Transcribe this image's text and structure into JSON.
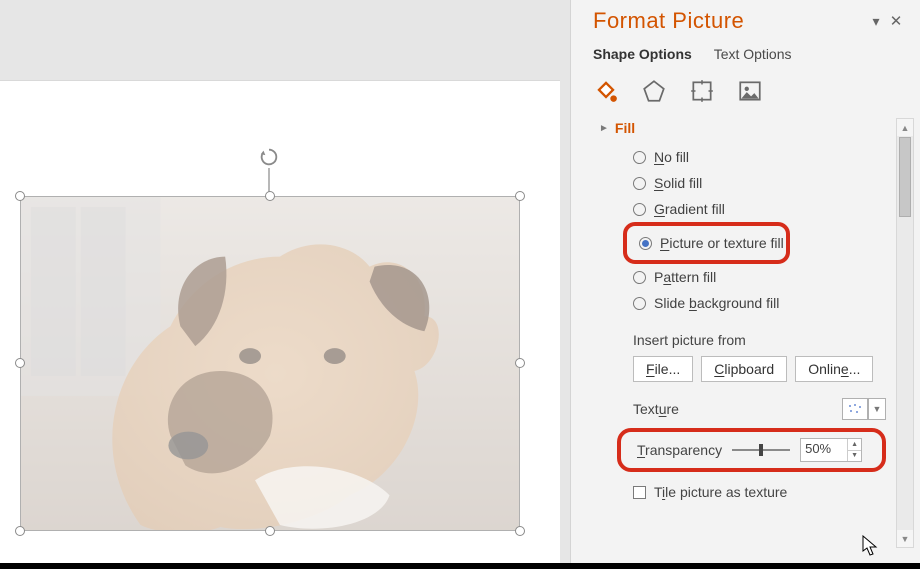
{
  "pane": {
    "title": "Format Picture",
    "tabs": {
      "shape": "Shape Options",
      "text": "Text Options"
    },
    "fill": {
      "section": "Fill",
      "items": {
        "no": {
          "pre": "",
          "u": "N",
          "post": "o fill"
        },
        "solid": {
          "pre": "",
          "u": "S",
          "post": "olid fill"
        },
        "gradient": {
          "pre": "",
          "u": "G",
          "post": "radient fill"
        },
        "picture": {
          "pre": "",
          "u": "P",
          "post": "icture or texture fill"
        },
        "pattern": {
          "pre": "P",
          "u": "a",
          "post": "ttern fill"
        },
        "slidebg": {
          "pre": "Slide ",
          "u": "b",
          "post": "ackground fill"
        }
      },
      "insert_label": "Insert picture from",
      "buttons": {
        "file": {
          "pre": "",
          "u": "F",
          "post": "ile..."
        },
        "clipboard": {
          "pre": "",
          "u": "C",
          "post": "lipboard"
        },
        "online": {
          "pre": "Onlin",
          "u": "e",
          "post": "..."
        }
      },
      "texture_label": {
        "pre": "Text",
        "u": "u",
        "post": "re"
      },
      "transparency": {
        "label": {
          "pre": "",
          "u": "T",
          "post": "ransparency"
        },
        "value": "50%"
      },
      "tile": {
        "pre": "T",
        "u": "i",
        "post": "le picture as texture"
      }
    }
  }
}
